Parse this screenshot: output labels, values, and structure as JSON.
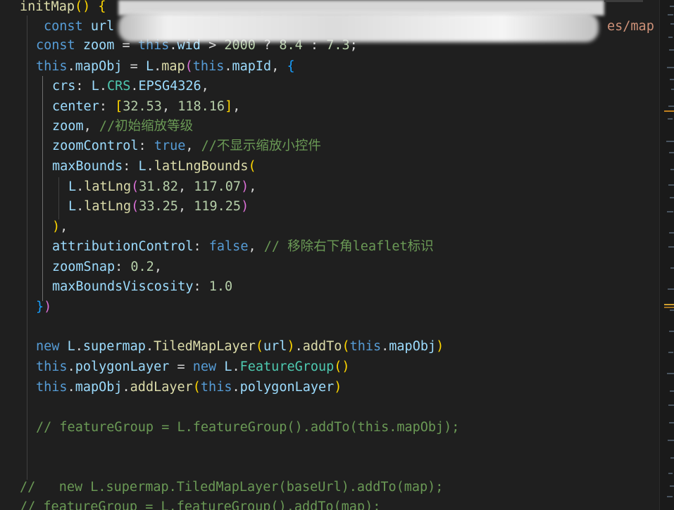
{
  "editor": {
    "lines": [
      {
        "tokens": [
          [
            "initMap",
            "f"
          ],
          [
            "() ",
            "b1"
          ],
          [
            "{",
            "b1"
          ]
        ]
      },
      {
        "tokens": [
          [
            "const ",
            "k"
          ],
          [
            "url",
            "v"
          ]
        ]
      },
      {
        "tokens": [
          [
            "const ",
            "k"
          ],
          [
            "zoom",
            "v"
          ],
          [
            " = ",
            "p"
          ],
          [
            "this",
            "k"
          ],
          [
            ".",
            "p"
          ],
          [
            "wid",
            "v"
          ],
          [
            " > ",
            "p"
          ],
          [
            "2000",
            "n"
          ],
          [
            " ? ",
            "p"
          ],
          [
            "8.4",
            "n"
          ],
          [
            " : ",
            "p"
          ],
          [
            "7.3",
            "n"
          ],
          [
            ";",
            "p"
          ]
        ]
      },
      {
        "tokens": [
          [
            "this",
            "k"
          ],
          [
            ".",
            "p"
          ],
          [
            "mapObj",
            "v"
          ],
          [
            " = ",
            "p"
          ],
          [
            "L",
            "v"
          ],
          [
            ".",
            "p"
          ],
          [
            "map",
            "f"
          ],
          [
            "(",
            "b2"
          ],
          [
            "this",
            "k"
          ],
          [
            ".",
            "p"
          ],
          [
            "mapId",
            "v"
          ],
          [
            ", ",
            "p"
          ],
          [
            "{",
            "b3"
          ]
        ]
      },
      {
        "tokens": [
          [
            "crs",
            "v"
          ],
          [
            ": ",
            "p"
          ],
          [
            "L",
            "v"
          ],
          [
            ".",
            "p"
          ],
          [
            "CRS",
            "t"
          ],
          [
            ".",
            "p"
          ],
          [
            "EPSG4326",
            "v"
          ],
          [
            ",",
            "p"
          ]
        ]
      },
      {
        "tokens": [
          [
            "center",
            "v"
          ],
          [
            ": ",
            "p"
          ],
          [
            "[",
            "b1"
          ],
          [
            "32.53",
            "n"
          ],
          [
            ", ",
            "p"
          ],
          [
            "118.16",
            "n"
          ],
          [
            "]",
            "b1"
          ],
          [
            ",",
            "p"
          ]
        ]
      },
      {
        "tokens": [
          [
            "zoom",
            "v"
          ],
          [
            ", ",
            "p"
          ],
          [
            "//初始缩放等级",
            "c"
          ]
        ]
      },
      {
        "tokens": [
          [
            "zoomControl",
            "v"
          ],
          [
            ": ",
            "p"
          ],
          [
            "true",
            "k"
          ],
          [
            ", ",
            "p"
          ],
          [
            "//不显示缩放小控件",
            "c"
          ]
        ]
      },
      {
        "tokens": [
          [
            "maxBounds",
            "v"
          ],
          [
            ": ",
            "p"
          ],
          [
            "L",
            "v"
          ],
          [
            ".",
            "p"
          ],
          [
            "latLngBounds",
            "f"
          ],
          [
            "(",
            "b1"
          ]
        ]
      },
      {
        "tokens": [
          [
            "L",
            "v"
          ],
          [
            ".",
            "p"
          ],
          [
            "latLng",
            "f"
          ],
          [
            "(",
            "b2"
          ],
          [
            "31.82",
            "n"
          ],
          [
            ", ",
            "p"
          ],
          [
            "117.07",
            "n"
          ],
          [
            ")",
            "b2"
          ],
          [
            ",",
            "p"
          ]
        ]
      },
      {
        "tokens": [
          [
            "L",
            "v"
          ],
          [
            ".",
            "p"
          ],
          [
            "latLng",
            "f"
          ],
          [
            "(",
            "b2"
          ],
          [
            "33.25",
            "n"
          ],
          [
            ", ",
            "p"
          ],
          [
            "119.25",
            "n"
          ],
          [
            ")",
            "b2"
          ]
        ]
      },
      {
        "tokens": [
          [
            ")",
            "b1"
          ],
          [
            ",",
            "p"
          ]
        ]
      },
      {
        "tokens": [
          [
            "attributionControl",
            "v"
          ],
          [
            ": ",
            "p"
          ],
          [
            "false",
            "k"
          ],
          [
            ", ",
            "p"
          ],
          [
            "// 移除右下角leaflet标识",
            "c"
          ]
        ]
      },
      {
        "tokens": [
          [
            "zoomSnap",
            "v"
          ],
          [
            ": ",
            "p"
          ],
          [
            "0.2",
            "n"
          ],
          [
            ",",
            "p"
          ]
        ]
      },
      {
        "tokens": [
          [
            "maxBoundsViscosity",
            "v"
          ],
          [
            ": ",
            "p"
          ],
          [
            "1.0",
            "n"
          ]
        ]
      },
      {
        "tokens": [
          [
            "}",
            "b3"
          ],
          [
            ")",
            "b2"
          ]
        ]
      },
      {
        "tokens": []
      },
      {
        "tokens": [
          [
            "new ",
            "k"
          ],
          [
            "L",
            "v"
          ],
          [
            ".",
            "p"
          ],
          [
            "supermap",
            "v"
          ],
          [
            ".",
            "p"
          ],
          [
            "TiledMapLayer",
            "f"
          ],
          [
            "(",
            "b1"
          ],
          [
            "url",
            "v"
          ],
          [
            ")",
            "b1"
          ],
          [
            ".",
            "p"
          ],
          [
            "addTo",
            "f"
          ],
          [
            "(",
            "b1"
          ],
          [
            "this",
            "k"
          ],
          [
            ".",
            "p"
          ],
          [
            "mapObj",
            "v"
          ],
          [
            ")",
            "b1"
          ]
        ]
      },
      {
        "tokens": [
          [
            "this",
            "k"
          ],
          [
            ".",
            "p"
          ],
          [
            "polygonLayer",
            "v"
          ],
          [
            " = ",
            "p"
          ],
          [
            "new ",
            "k"
          ],
          [
            "L",
            "v"
          ],
          [
            ".",
            "p"
          ],
          [
            "FeatureGroup",
            "t"
          ],
          [
            "()",
            "b1"
          ]
        ]
      },
      {
        "tokens": [
          [
            "this",
            "k"
          ],
          [
            ".",
            "p"
          ],
          [
            "mapObj",
            "v"
          ],
          [
            ".",
            "p"
          ],
          [
            "addLayer",
            "f"
          ],
          [
            "(",
            "b1"
          ],
          [
            "this",
            "k"
          ],
          [
            ".",
            "p"
          ],
          [
            "polygonLayer",
            "v"
          ],
          [
            ")",
            "b1"
          ]
        ]
      },
      {
        "tokens": []
      },
      {
        "tokens": [
          [
            "// featureGroup = L.featureGroup().addTo(this.mapObj);",
            "c"
          ]
        ]
      },
      {
        "tokens": []
      },
      {
        "tokens": []
      },
      {
        "tokens": [
          [
            "//   new L.supermap.TiledMapLayer(baseUrl).addTo(map);",
            "c"
          ]
        ]
      },
      {
        "tokens": [
          [
            "// featureGroup = L.featureGroup().addTo(map);",
            "c"
          ]
        ]
      }
    ],
    "partial_visible_text": "es/map"
  },
  "colors": {
    "background": "#1f1f1f",
    "keyword": "#569cd6",
    "variable": "#9cdcfe",
    "function": "#dcdcaa",
    "number": "#b5cea8",
    "comment": "#6a9955",
    "type": "#4ec9b0",
    "string": "#ce9178"
  }
}
